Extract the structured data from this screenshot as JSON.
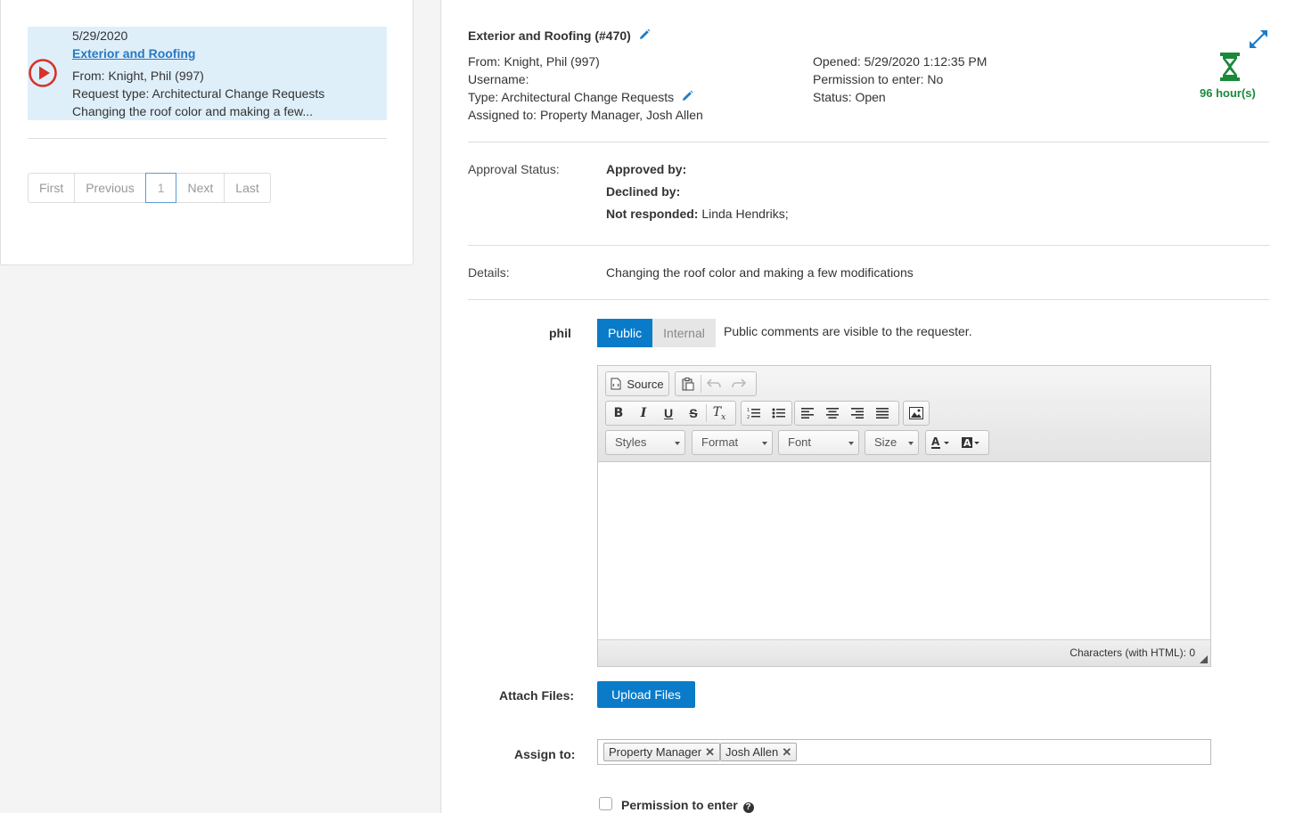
{
  "list": {
    "items": [
      {
        "date": "5/29/2020",
        "title": "Exterior and Roofing",
        "from": "From: Knight, Phil (997)",
        "request_type": "Request type: Architectural Change Requests",
        "description": "Changing the roof color and making a few..."
      }
    ],
    "pager": {
      "first": "First",
      "previous": "Previous",
      "current": "1",
      "next": "Next",
      "last": "Last"
    }
  },
  "request": {
    "title": "Exterior and Roofing (#470)",
    "from": "From: Knight, Phil (997)",
    "username": "Username:",
    "type": "Type: Architectural Change Requests",
    "assigned_to": "Assigned to: Property Manager, Josh Allen",
    "opened": "Opened: 5/29/2020 1:12:35 PM",
    "permission": "Permission to enter: No",
    "status": "Status: Open",
    "timer": "96 hour(s)",
    "timer_color": "#1a8a3a"
  },
  "approval": {
    "label": "Approval Status:",
    "approved_by_label": "Approved by:",
    "approved_by_value": "",
    "declined_by_label": "Declined by:",
    "declined_by_value": "",
    "not_responded_label": "Not responded:",
    "not_responded_value": " Linda Hendriks;"
  },
  "details": {
    "label": "Details:",
    "value": "Changing the roof color and making a few modifications"
  },
  "comment": {
    "user": "phil",
    "public_label": "Public",
    "internal_label": "Internal",
    "visibility_note": "Public comments are visible to the requester.",
    "accent": "#0a7bc9"
  },
  "editor": {
    "source_label": "Source",
    "styles": "Styles",
    "format": "Format",
    "font": "Font",
    "size": "Size",
    "char_count": "Characters (with HTML): 0"
  },
  "attach": {
    "label": "Attach Files:",
    "button": "Upload Files"
  },
  "assign": {
    "label": "Assign to:",
    "tags": [
      "Property Manager",
      "Josh Allen"
    ]
  },
  "permission_to_enter": {
    "label": "Permission to enter",
    "checked": false
  }
}
